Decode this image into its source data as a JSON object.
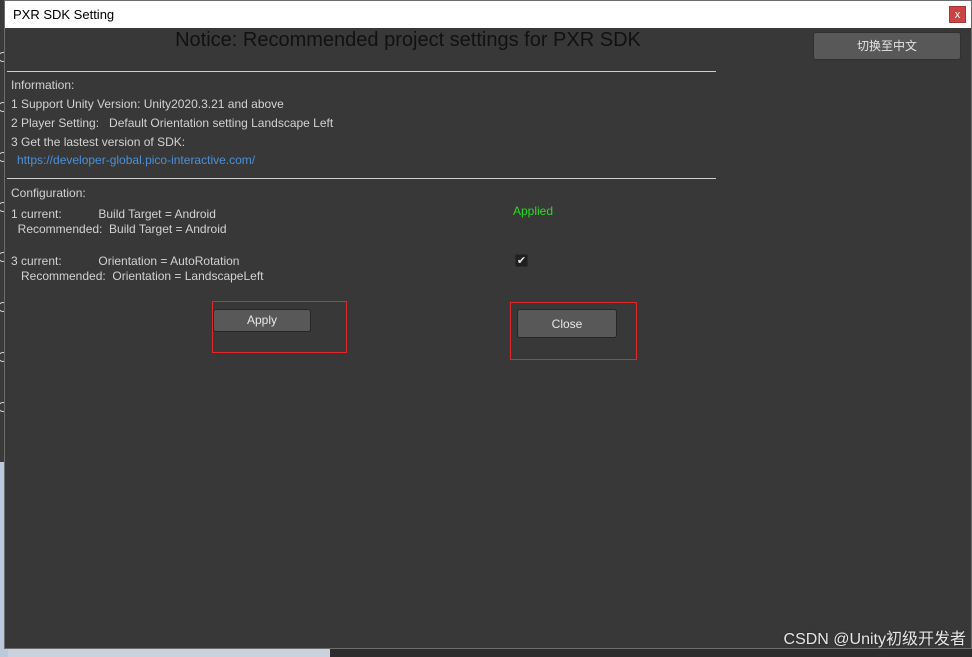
{
  "window": {
    "title": "PXR SDK Setting",
    "close_glyph": "x",
    "notice": "Notice: Recommended project settings for PXR SDK",
    "language_button": "切换至中文"
  },
  "information": {
    "heading": "Information:",
    "line1": "1 Support Unity Version: Unity2020.3.21 and above",
    "line2": "2 Player Setting:   Default Orientation setting Landscape Left",
    "line3": "3 Get the lastest version of SDK:",
    "link": "https://developer-global.pico-interactive.com/"
  },
  "configuration": {
    "heading": "Configuration:",
    "item1_current": "1 current:           Build Target = Android",
    "item1_recommended": "  Recommended:  Build Target = Android",
    "item1_status": "Applied",
    "item3_current": "3 current:           Orientation = AutoRotation",
    "item3_recommended": "   Recommended:  Orientation = LandscapeLeft",
    "item3_checkbox_checked": true,
    "checkmark_glyph": "✔"
  },
  "buttons": {
    "apply": "Apply",
    "close": "Close"
  },
  "watermark": "CSDN @Unity初级开发者",
  "colors": {
    "window_bg": "#383838",
    "applied_text": "#27d827",
    "link_text": "#4a90d9",
    "highlight_box": "#e02828"
  }
}
